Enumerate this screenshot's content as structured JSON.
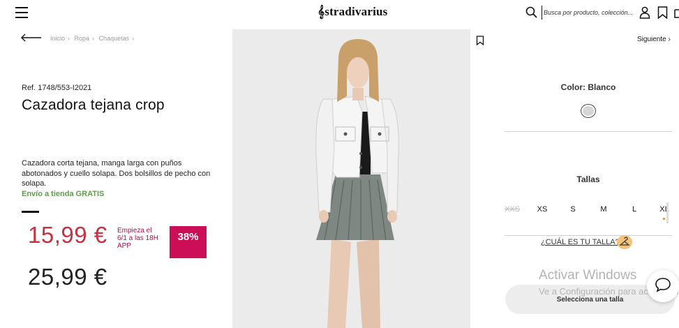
{
  "header": {
    "logo": "stradivarius",
    "search_placeholder": "Busca por producto, colección..."
  },
  "breadcrumb": [
    "Inicio",
    "Ropa",
    "Chaquetas"
  ],
  "product": {
    "ref": "Ref. 1748/553-I2021",
    "title": "Cazadora tejana crop",
    "description": "Cazadora corta tejana, manga larga con puños abotonados y cuello solapa. Dos bolsillos de pecho con solapa.",
    "shipping": "Envío a tienda GRATIS",
    "price_sale": "15,99 €",
    "promo": "Empieza el 6/1 a las 18H APP",
    "discount": "38%",
    "price_old": "25,99 €"
  },
  "nav": {
    "next": "Siguiente"
  },
  "options": {
    "color_label": "Color: Blanco",
    "sizes_label": "Tallas",
    "sizes": [
      {
        "label": "XXS",
        "available": false
      },
      {
        "label": "XS",
        "available": true
      },
      {
        "label": "S",
        "available": true
      },
      {
        "label": "M",
        "available": true
      },
      {
        "label": "L",
        "available": true
      },
      {
        "label": "XL",
        "available": true
      }
    ],
    "fit_link": "¿CUÁL ES TU TALLA?",
    "add_button": "Selecciona una talla"
  },
  "watermark": {
    "title": "Activar Windows",
    "subtitle": "Ve a Configuración para activar Windows."
  },
  "colors": {
    "sale": "#c8313f",
    "promo": "#a8124e",
    "badge": "#cc0e56",
    "shipping": "#5e9a4a"
  }
}
